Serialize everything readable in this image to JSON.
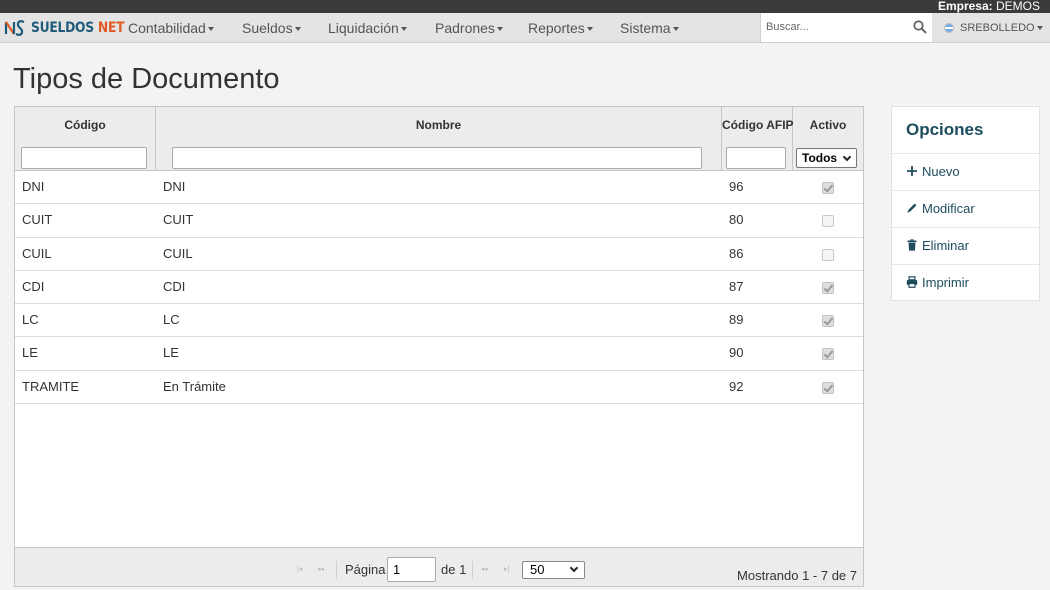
{
  "topbar": {
    "empresa_label": "Empresa:",
    "empresa_value": "DEMOS"
  },
  "brand": {
    "name_part1": "SUELDOS",
    "name_part2": "NET"
  },
  "nav": {
    "menus": [
      {
        "label": "Contabilidad"
      },
      {
        "label": "Sueldos"
      },
      {
        "label": "Liquidación"
      },
      {
        "label": "Padrones"
      },
      {
        "label": "Reportes"
      },
      {
        "label": "Sistema"
      }
    ],
    "search_placeholder": "Buscar...",
    "user": "SREBOLLEDO"
  },
  "page": {
    "title": "Tipos de Documento"
  },
  "grid": {
    "columns": [
      "Código",
      "Nombre",
      "Código AFIP",
      "Activo"
    ],
    "activo_filter_value": "Todos",
    "rows": [
      {
        "codigo": "DNI",
        "nombre": "DNI",
        "afip": "96",
        "activo": true
      },
      {
        "codigo": "CUIT",
        "nombre": "CUIT",
        "afip": "80",
        "activo": false
      },
      {
        "codigo": "CUIL",
        "nombre": "CUIL",
        "afip": "86",
        "activo": false
      },
      {
        "codigo": "CDI",
        "nombre": "CDI",
        "afip": "87",
        "activo": true
      },
      {
        "codigo": "LC",
        "nombre": "LC",
        "afip": "89",
        "activo": true
      },
      {
        "codigo": "LE",
        "nombre": "LE",
        "afip": "90",
        "activo": true
      },
      {
        "codigo": "TRAMITE",
        "nombre": "En Trámite",
        "afip": "92",
        "activo": true
      }
    ]
  },
  "pager": {
    "page_label": "Página",
    "page_value": "1",
    "of_label": "de 1",
    "page_size": "50",
    "info": "Mostrando 1 - 7 de 7"
  },
  "options": {
    "title": "Opciones",
    "items": [
      {
        "label": "Nuevo",
        "icon": "plus-icon"
      },
      {
        "label": "Modificar",
        "icon": "pencil-icon"
      },
      {
        "label": "Eliminar",
        "icon": "trash-icon"
      },
      {
        "label": "Imprimir",
        "icon": "printer-icon"
      }
    ]
  },
  "colors": {
    "accent": "#1e4d5e",
    "brand_blue": "#1f5b7a",
    "brand_orange": "#e05a24"
  }
}
